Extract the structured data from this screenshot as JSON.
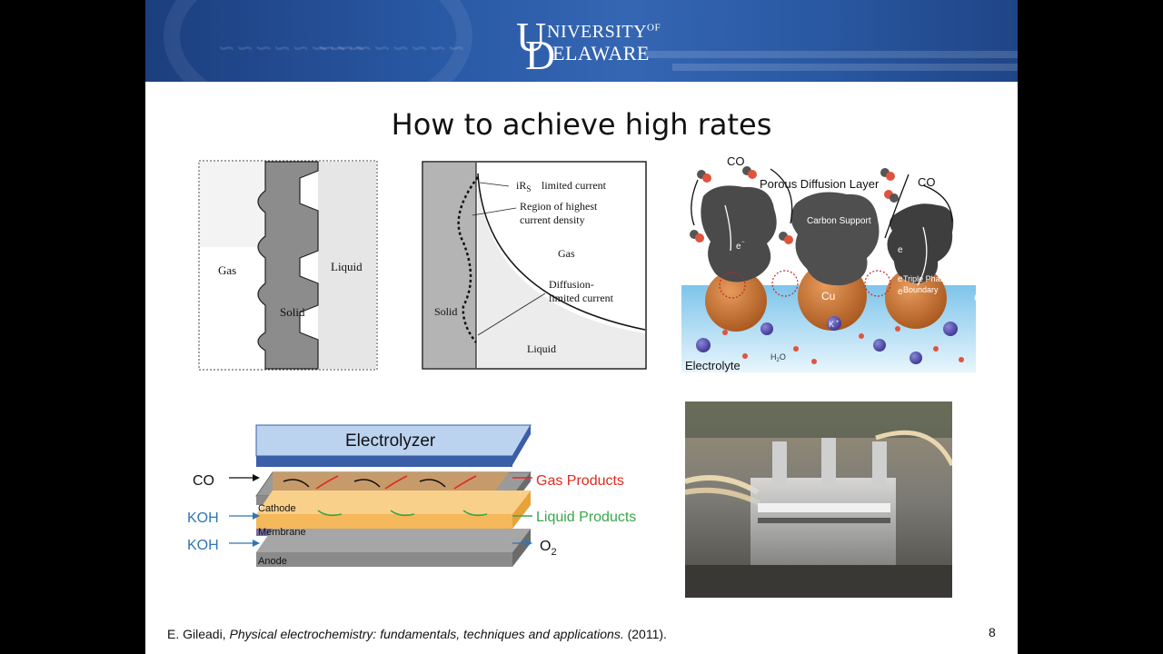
{
  "slide": {
    "title": "How to achieve high rates",
    "page_number": "8",
    "citation": {
      "author": "E. Gileadi,",
      "work": "Physical electrochemistry: fundamentals, techniques and applications.",
      "year": "(2011)."
    }
  },
  "logo": {
    "initial_u": "U",
    "initial_d": "D",
    "university": "NIVERSITY",
    "of": "OF",
    "delaware": "ELAWARE"
  },
  "fig1": {
    "gas": "Gas",
    "liquid": "Liquid",
    "solid": "Solid"
  },
  "fig2": {
    "ir_limited": "limited current",
    "highest_density_line1": "Region of highest",
    "highest_density_line2": "current density",
    "gas": "Gas",
    "diffusion_line1": "Diffusion-",
    "diffusion_line2": "limited current",
    "solid": "Solid",
    "liquid": "Liquid"
  },
  "fig3": {
    "co_left": "CO",
    "co_right": "CO",
    "porous_layer": "Porous Diffusion Layer",
    "carbon_support": "Carbon Support",
    "electron": "e",
    "triple_phase_line1": "Triple Phase",
    "triple_phase_line2": "Boundary",
    "cu": "Cu",
    "k_ion": "K",
    "water": "H",
    "electrolyte": "Electrolyte"
  },
  "fig4": {
    "electrolyzer": "Electrolyzer",
    "co": "CO",
    "koh_top": "KOH",
    "koh_bottom": "KOH",
    "cathode": "Cathode",
    "membrane": "Membrane",
    "anode": "Anode",
    "gas_products": "Gas Products",
    "liquid_products": "Liquid Products",
    "o2": "O"
  },
  "colors": {
    "banner": "#2a5aa6",
    "koh_blue": "#2e75b6",
    "gas_red": "#e02a20",
    "liquid_green": "#3aa64a",
    "cu_orange": "#c8702e",
    "electrolyte_blue": "#9dd3f0"
  }
}
